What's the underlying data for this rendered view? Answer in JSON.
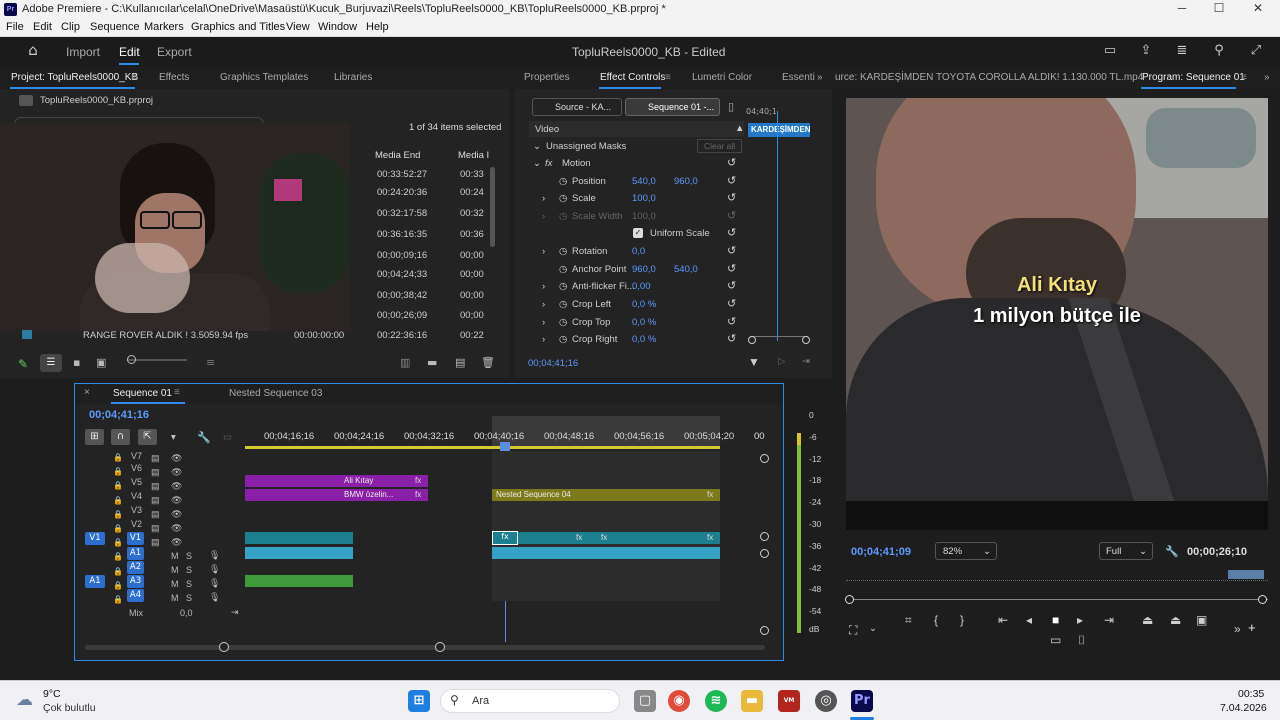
{
  "window": {
    "title": "Adobe Premiere - C:\\Kullanıcılar\\celal\\OneDrive\\Masaüstü\\Kucuk_Burjuvazi\\Reels\\TopluReels0000_KB\\TopluReels0000_KB.prproj *",
    "minimize": "─",
    "maximize": "☐",
    "close": "✕"
  },
  "menu": [
    "File",
    "Edit",
    "Clip",
    "Sequence",
    "Markers",
    "Graphics and Titles",
    "View",
    "Window",
    "Help"
  ],
  "header": {
    "home_icon": "home-icon",
    "import": "Import",
    "edit": "Edit",
    "export": "Export",
    "project_title": "TopluReels0000_KB - Edited"
  },
  "project_panel": {
    "tabs": [
      "Project: TopluReels0000_KB",
      "Effects",
      "Graphics Templates",
      "Libraries"
    ],
    "file": "TopluReels0000_KB.prproj",
    "items_count": "1 of 34 items selected",
    "col_media_end": "Media End",
    "col_media_d": "Media I",
    "media_end": [
      "00:33:52:27",
      "00:24:20:36",
      "00:32:17:58",
      "00:36:16:35",
      "00;00;09;16",
      "00;04;24;33",
      "00;00;38;42",
      "00;00;26;09",
      "00:22:36:16"
    ],
    "media_d": [
      "00:33",
      "00:24",
      "00:32",
      "00:36",
      "00;00",
      "00;00",
      "00;00",
      "00;00",
      "00:22"
    ],
    "bottom_row": {
      "name": "RANGE ROVER ALDIK ! 3.50",
      "fps": "59.94 fps",
      "start": "00:00:00:00"
    }
  },
  "effect_controls": {
    "tabs": [
      "Properties",
      "Effect Controls",
      "Lumetri Color",
      "Essenti"
    ],
    "source_btn": "Source - KA...",
    "seq_btn": "Sequence 01 -...",
    "mini_time": "04;40;1",
    "mini_clip": "KARDEŞİMDEN",
    "section": "Video",
    "masks": "Unassigned Masks",
    "clear_all": "Clear all",
    "motion": "Motion",
    "props": [
      {
        "name": "Position",
        "v1": "540,0",
        "v2": "960,0"
      },
      {
        "name": "Scale",
        "v1": "100,0",
        "v2": ""
      },
      {
        "name": "Scale Width",
        "v1": "100,0",
        "v2": ""
      },
      {
        "name": "Uniform Scale",
        "v1": "",
        "v2": ""
      },
      {
        "name": "Rotation",
        "v1": "0,0",
        "v2": ""
      },
      {
        "name": "Anchor Point",
        "v1": "960,0",
        "v2": "540,0"
      },
      {
        "name": "Anti-flicker Fi...",
        "v1": "0,00",
        "v2": ""
      },
      {
        "name": "Crop Left",
        "v1": "0,0 %",
        "v2": ""
      },
      {
        "name": "Crop Top",
        "v1": "0,0 %",
        "v2": ""
      },
      {
        "name": "Crop Right",
        "v1": "0,0 %",
        "v2": ""
      }
    ],
    "timecode": "00;04;41;16"
  },
  "program": {
    "source_tab": "urce: KARDEŞİMDEN TOYOTA COROLLA ALDIK! 1.130.000 TL.mp4",
    "program_tab": "Program: Sequence 01",
    "caption_name": "Ali Kıtay",
    "caption_line": "1 milyon bütçe ile",
    "timecode": "00;04;41;09",
    "zoom": "82%",
    "quality": "Full",
    "duration": "00;00;26;10"
  },
  "timeline": {
    "tabs": [
      "Sequence 01",
      "Nested Sequence 03"
    ],
    "timecode": "00;04;41;16",
    "ruler": [
      "00;04;16;16",
      "00;04;24;16",
      "00;04;32;16",
      "00;04;40;16",
      "00;04;48;16",
      "00;04;56;16",
      "00;05;04;20",
      "00"
    ],
    "video_tracks": [
      "V7",
      "V6",
      "V5",
      "V4",
      "V3",
      "V2",
      "V1"
    ],
    "audio_tracks": [
      "A1",
      "A2",
      "A3",
      "A4"
    ],
    "src_v": "V1",
    "src_a": "A1",
    "mix": "Mix",
    "mix_val": "0,0",
    "clips": {
      "v5": "Ali Kıtay",
      "v4": "BMW özelin...",
      "nested": "Nested Sequence 04",
      "fx": "fx"
    }
  },
  "meter": [
    "0",
    "-6",
    "-12",
    "-18",
    "-24",
    "-30",
    "-36",
    "-42",
    "-48",
    "-54",
    "dB"
  ],
  "taskbar": {
    "temp": "9°C",
    "weather": "Çok bulutlu",
    "search": "Ara",
    "time": "00:35",
    "date": "7.04.2026"
  },
  "colors": {
    "accent": "#2d8ceb",
    "purple_clip": "#8a1fa8",
    "olive_clip": "#7c7a1a",
    "teal_clip": "#1c7f8f",
    "audio_clip": "#36a2c6",
    "green_audio": "#3f9b3a"
  }
}
